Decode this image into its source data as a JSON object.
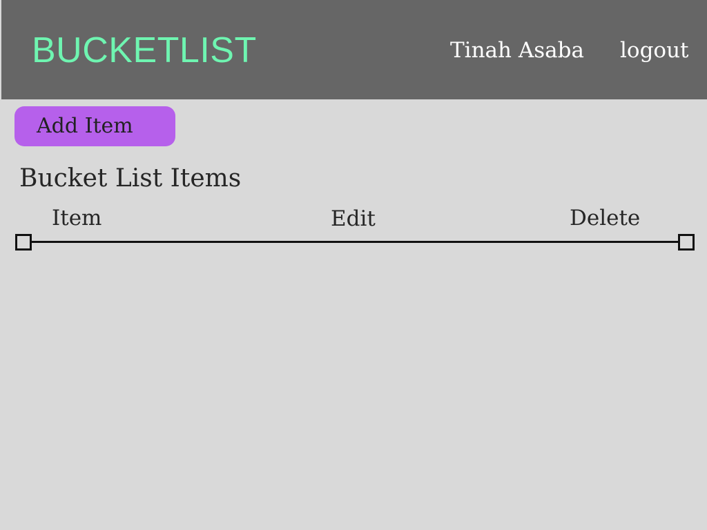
{
  "header": {
    "brand": "BUCKETLIST",
    "user_name": "Tinah Asaba",
    "logout_label": "logout"
  },
  "toolbar": {
    "add_label": "Add Item"
  },
  "list": {
    "title": "Bucket List Items",
    "columns": [
      "Item",
      "Edit",
      "Delete"
    ]
  },
  "colors": {
    "header_bg": "#666666",
    "brand": "#6ff5b1",
    "page_bg": "#d9d9d9",
    "button_bg": "#b660eb",
    "text": "#262626"
  }
}
